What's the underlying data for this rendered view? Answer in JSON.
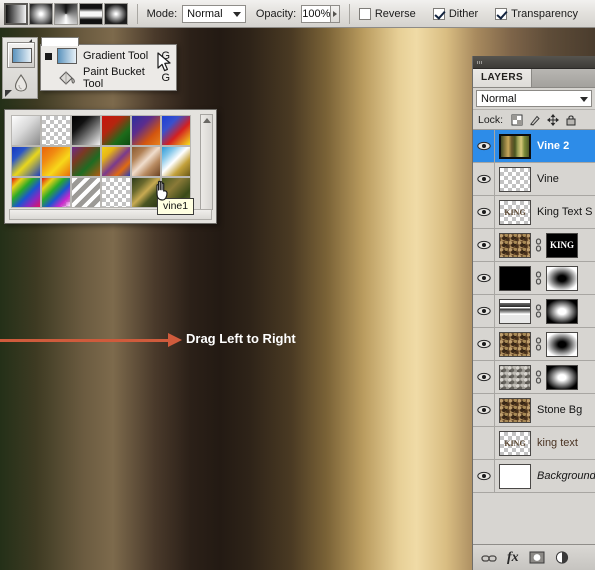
{
  "options_bar": {
    "gradient_types": [
      {
        "name": "linear-gradient-type",
        "label": "Linear Gradient",
        "selected": true
      },
      {
        "name": "radial-gradient-type",
        "label": "Radial Gradient",
        "selected": false
      },
      {
        "name": "angle-gradient-type",
        "label": "Angle Gradient",
        "selected": false
      },
      {
        "name": "reflected-gradient-type",
        "label": "Reflected Gradient",
        "selected": false
      },
      {
        "name": "diamond-gradient-type",
        "label": "Diamond Gradient",
        "selected": false
      }
    ],
    "mode_label": "Mode:",
    "mode_value": "Normal",
    "opacity_label": "Opacity:",
    "opacity_value": "100%",
    "checkboxes": [
      {
        "label": "Reverse",
        "checked": false
      },
      {
        "label": "Dither",
        "checked": true
      },
      {
        "label": "Transparency",
        "checked": true
      }
    ]
  },
  "tool_flyout": {
    "items": [
      {
        "label": "Gradient Tool",
        "shortcut": "G",
        "active": true
      },
      {
        "label": "Paint Bucket Tool",
        "shortcut": "G",
        "active": false
      }
    ]
  },
  "gradient_picker": {
    "tooltip": "vine1",
    "swatches": [
      {
        "name": "foreground-to-background",
        "style": "linear-gradient(135deg,#fefefe 0%,#d8d8d8 45%,#8a8a8a 100%)"
      },
      {
        "name": "foreground-to-transparent",
        "style": "checker"
      },
      {
        "name": "black-to-white",
        "style": "linear-gradient(135deg,#000 0%,#111 30%,#f2f2f2 100%)"
      },
      {
        "name": "red-green",
        "style": "linear-gradient(135deg,#c9140f 0%,#b4260f 35%,#1d6b1a 70%,#0d4d12 100%)"
      },
      {
        "name": "violet-orange",
        "style": "linear-gradient(135deg,#2b2fa0 0%,#5b2d8e 35%,#d2550f 70%,#e8811b 100%)"
      },
      {
        "name": "blue-red-yellow",
        "style": "linear-gradient(135deg,#1a3fd6 0%,#3a50cc 30%,#d42020 60%,#f5e21c 100%)"
      },
      {
        "name": "blue-yellow-blue",
        "style": "linear-gradient(135deg,#1336c0 0%,#2a55c8 25%,#e9d71c 55%,#1c3fc2 100%)"
      },
      {
        "name": "orange-yellow-orange",
        "style": "linear-gradient(135deg,#e8620c 0%,#f08a12 30%,#f7d81a 62%,#e86c0c 100%)"
      },
      {
        "name": "violet-green-orange",
        "style": "linear-gradient(135deg,#6b2a8c 0%,#7a3a22 30%,#1e6b22 62%,#b25a12 100%)"
      },
      {
        "name": "yellow-violet-orange-blue",
        "style": "linear-gradient(135deg,#f0d218 0%,#e8b714 22%,#7a3a8c 52%,#e06a12 75%,#2a3fb5 100%)"
      },
      {
        "name": "copper",
        "style": "linear-gradient(135deg,#8a5a30 0%,#b08055 25%,#f0ddcc 48%,#b88a60 70%,#6b4222 100%)"
      },
      {
        "name": "blue-gold",
        "style": "linear-gradient(135deg,#2f9ad8 0%,#7fc4e8 22%,#ffffff 46%,#c2a03a 70%,#6b5a18 100%)"
      },
      {
        "name": "spectrum",
        "style": "linear-gradient(135deg,#e01515 0%,#e8d018 18%,#2aaa28 38%,#1a55d0 58%,#8a28c0 78%,#e01560 100%)"
      },
      {
        "name": "transparent-rainbow",
        "style": "linear-gradient(135deg,#e01515 0%,#e8d018 20%,#2aaa28 40%,#1a55d0 60%,#cc28cc 80%,#ffffff 100%)"
      },
      {
        "name": "transparent-stripes",
        "style": "repeating-linear-gradient(135deg,#ffffff 0 4px,#9c9a96 4px 9px)"
      },
      {
        "name": "checker-swatch",
        "style": "checker"
      },
      {
        "name": "vine1",
        "style": "linear-gradient(135deg,#2c3a18 0%,#6b6a2e 28%,#c8aa52 48%,#4a5522 68%,#2a3514 100%)"
      },
      {
        "name": "vine2",
        "style": "linear-gradient(135deg,#4a5a22 0%,#8a7a38 35%,#3a4a18 70%,#5a6828 100%)"
      }
    ]
  },
  "annotation": {
    "text": "Drag Left to Right",
    "arrow_color": "#cf5b3c"
  },
  "layers_panel": {
    "tab_label": "LAYERS",
    "blend_mode": "Normal",
    "lock_label": "Lock:",
    "lock_icons": [
      "lock-transparent-pixels-icon",
      "lock-image-pixels-icon",
      "lock-position-icon",
      "lock-all-icon"
    ],
    "layers": [
      {
        "name": "Vine 2",
        "visible": true,
        "selected": true,
        "thumb": "th-vine2",
        "has_link": false,
        "mask": null,
        "style": ""
      },
      {
        "name": "Vine",
        "visible": true,
        "selected": false,
        "thumb": "checker",
        "has_link": false,
        "mask": null,
        "style": ""
      },
      {
        "name": "King Text S",
        "visible": true,
        "selected": false,
        "thumb": "th-kingtext",
        "has_link": false,
        "mask": null,
        "style": ""
      },
      {
        "name": "",
        "visible": true,
        "selected": false,
        "thumb": "th-noise-brown",
        "has_link": true,
        "mask": "th-maskword",
        "style": ""
      },
      {
        "name": "",
        "visible": true,
        "selected": false,
        "thumb": "th-black",
        "has_link": true,
        "mask": "th-mask-black",
        "style": ""
      },
      {
        "name": "",
        "visible": true,
        "selected": false,
        "thumb": "th-strip",
        "has_link": true,
        "mask": "th-mask-white",
        "style": ""
      },
      {
        "name": "",
        "visible": true,
        "selected": false,
        "thumb": "th-noise-brown",
        "has_link": true,
        "mask": "th-mask-black",
        "style": ""
      },
      {
        "name": "",
        "visible": true,
        "selected": false,
        "thumb": "th-noise-gray",
        "has_link": true,
        "mask": "th-mask-white",
        "style": ""
      },
      {
        "name": "Stone Bg",
        "visible": true,
        "selected": false,
        "thumb": "th-noise-brown",
        "has_link": false,
        "mask": null,
        "style": ""
      },
      {
        "name": "king text",
        "visible": false,
        "selected": false,
        "thumb": "th-kingtext",
        "has_link": false,
        "mask": null,
        "style": "brownish"
      },
      {
        "name": "Background",
        "visible": true,
        "selected": false,
        "thumb": "th-white",
        "has_link": false,
        "mask": null,
        "style": "italic"
      }
    ],
    "bottom_icons": [
      "link-layers-icon",
      "layer-style-fx-icon",
      "add-layer-mask-icon",
      "adjustment-layer-icon"
    ],
    "fx_label": "fx"
  }
}
